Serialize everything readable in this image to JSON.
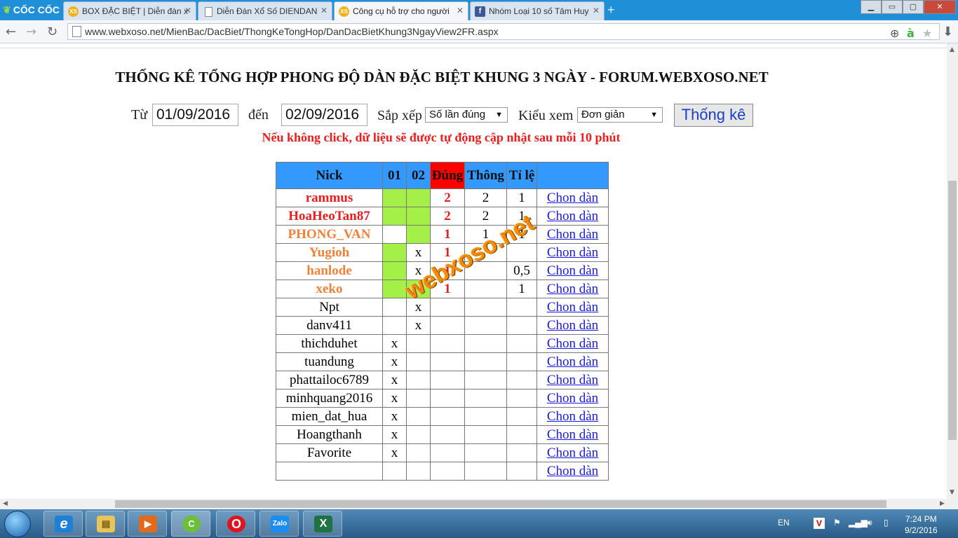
{
  "browser": {
    "logo_text": "CỐC CỐC",
    "tabs": [
      {
        "title": "BOX ĐẶC BIỆT | Diễn đàn x",
        "active": false
      },
      {
        "title": "Diễn Đàn Xổ Số DIENDAN",
        "active": false
      },
      {
        "title": "Công cụ hỗ trợ cho người",
        "active": true
      },
      {
        "title": "Nhóm Loại 10 số Tâm Huy",
        "active": false
      }
    ],
    "url": "www.webxoso.net/MienBac/DacBiet/ThongKeTongHop/DanDacBietKhung3NgayView2FR.aspx"
  },
  "page": {
    "title": "THỐNG KÊ TỔNG HỢP PHONG ĐỘ DÀN ĐẶC BIỆT KHUNG 3 NGÀY - FORUM.WEBXOSO.NET",
    "form": {
      "from_label": "Từ",
      "from_value": "01/09/2016",
      "to_label": "đến",
      "to_value": "02/09/2016",
      "sort_label": "Sắp xếp",
      "sort_value": "Số lần đúng",
      "view_label": "Kiểu xem",
      "view_value": "Đơn giản",
      "submit_label": "Thống kê"
    },
    "notice": "Nếu không click, dữ liệu sẽ được tự động cập nhật sau mỗi 10 phút",
    "watermark": "webxoso.net"
  },
  "table": {
    "headers": {
      "nick": "Nick",
      "d1": "01",
      "d2": "02",
      "dung": "Đúng",
      "thong": "Thông",
      "tile": "Tỉ lệ"
    },
    "link_label": "Chon dàn",
    "rows": [
      {
        "nick": "rammus",
        "d1": "",
        "d2": "",
        "dung": "2",
        "thong": "2",
        "tile": "1"
      },
      {
        "nick": "HoaHeoTan87",
        "d1": "",
        "d2": "",
        "dung": "2",
        "thong": "2",
        "tile": "1"
      },
      {
        "nick": "PHONG_VAN",
        "d1": "",
        "d2": "",
        "dung": "1",
        "thong": "1",
        "tile": "1"
      },
      {
        "nick": "Yugioh",
        "d1": "",
        "d2": "x",
        "dung": "1",
        "thong": "",
        "tile": ""
      },
      {
        "nick": "hanlode",
        "d1": "",
        "d2": "x",
        "dung": "1",
        "thong": "",
        "tile": "0,5"
      },
      {
        "nick": "xeko",
        "d1": "",
        "d2": "",
        "dung": "1",
        "thong": "",
        "tile": "1"
      },
      {
        "nick": "Npt",
        "d1": "",
        "d2": "x",
        "dung": "",
        "thong": "",
        "tile": ""
      },
      {
        "nick": "danv411",
        "d1": "",
        "d2": "x",
        "dung": "",
        "thong": "",
        "tile": ""
      },
      {
        "nick": "thichduhet",
        "d1": "x",
        "d2": "",
        "dung": "",
        "thong": "",
        "tile": ""
      },
      {
        "nick": "tuandung",
        "d1": "x",
        "d2": "",
        "dung": "",
        "thong": "",
        "tile": ""
      },
      {
        "nick": "phattailoc6789",
        "d1": "x",
        "d2": "",
        "dung": "",
        "thong": "",
        "tile": ""
      },
      {
        "nick": "minhquang2016",
        "d1": "x",
        "d2": "",
        "dung": "",
        "thong": "",
        "tile": ""
      },
      {
        "nick": "mien_dat_hua",
        "d1": "x",
        "d2": "",
        "dung": "",
        "thong": "",
        "tile": ""
      },
      {
        "nick": "Hoangthanh",
        "d1": "x",
        "d2": "",
        "dung": "",
        "thong": "",
        "tile": ""
      },
      {
        "nick": "Favorite",
        "d1": "x",
        "d2": "",
        "dung": "",
        "thong": "",
        "tile": ""
      },
      {
        "nick": "",
        "d1": "",
        "d2": "",
        "dung": "",
        "thong": "",
        "tile": ""
      }
    ]
  },
  "taskbar": {
    "apps": [
      {
        "name": "ie",
        "glyph": "e"
      },
      {
        "name": "explorer",
        "glyph": "▤"
      },
      {
        "name": "media",
        "glyph": "▶"
      },
      {
        "name": "coccoc",
        "glyph": "C"
      },
      {
        "name": "opera",
        "glyph": "O"
      },
      {
        "name": "zalo",
        "glyph": "Zalo"
      },
      {
        "name": "excel",
        "glyph": "X"
      }
    ],
    "language": "EN",
    "time": "7:24 PM",
    "date": "9/2/2016"
  },
  "colors": {
    "header_blue": "#3399ff",
    "dung_red": "#ff0000",
    "hit_green": "#a5f048",
    "nick_red": "#ee1c1c",
    "nick_orange": "#f28038",
    "link_blue": "#1a1ae0"
  }
}
